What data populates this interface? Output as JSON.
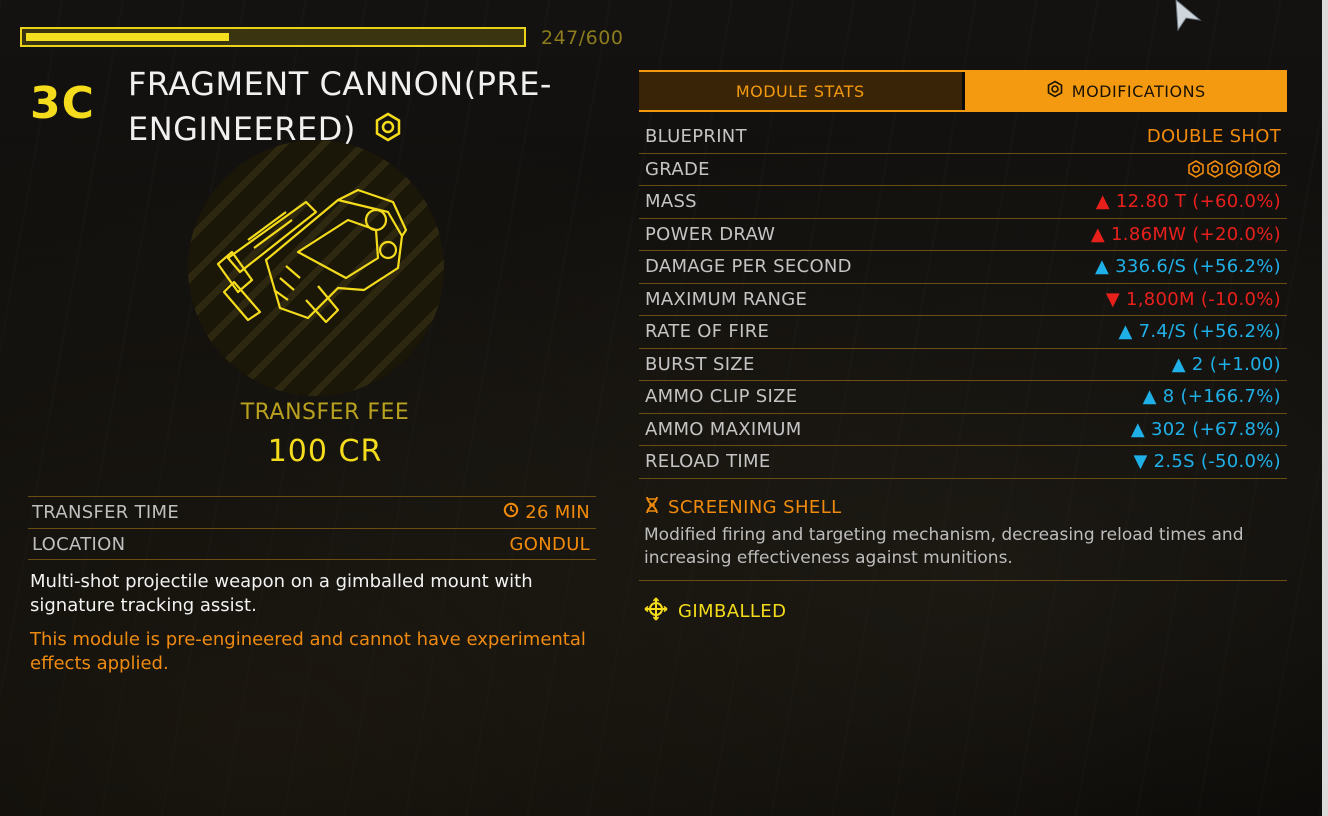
{
  "capacity": {
    "text": "247/600",
    "fraction": 0.4117
  },
  "module": {
    "class": "3C",
    "title": "FRAGMENT CANNON(PRE-ENGINEERED)",
    "icon": "engineered-hex-icon"
  },
  "transfer": {
    "fee_label": "TRANSFER FEE",
    "fee_value": "100 CR"
  },
  "info": [
    {
      "key": "TRANSFER TIME",
      "value": "26 MIN",
      "icon": "clock-icon"
    },
    {
      "key": "LOCATION",
      "value": "GONDUL"
    }
  ],
  "description": "Multi-shot projectile weapon on a gimballed mount with signature tracking assist.",
  "warning": "This module is pre-engineered and cannot have experimental effects applied.",
  "tabs": [
    {
      "label": "MODULE STATS",
      "active": false
    },
    {
      "label": "MODIFICATIONS",
      "active": true,
      "icon": "engineered-hex-icon"
    }
  ],
  "stats": [
    {
      "key": "BLUEPRINT",
      "value": "DOUBLE SHOT",
      "color": "orange"
    },
    {
      "key": "GRADE",
      "value": "",
      "grade": 5,
      "color": "orange"
    },
    {
      "key": "MASS",
      "value": "▲ 12.80 T (+60.0%)",
      "color": "red"
    },
    {
      "key": "POWER DRAW",
      "value": "▲ 1.86MW (+20.0%)",
      "color": "red"
    },
    {
      "key": "DAMAGE PER SECOND",
      "value": "▲ 336.6/S (+56.2%)",
      "color": "blue"
    },
    {
      "key": "MAXIMUM RANGE",
      "value": "▼ 1,800M (-10.0%)",
      "color": "red"
    },
    {
      "key": "RATE OF FIRE",
      "value": "▲ 7.4/S (+56.2%)",
      "color": "blue"
    },
    {
      "key": "BURST SIZE",
      "value": "▲ 2 (+1.00)",
      "color": "blue"
    },
    {
      "key": "AMMO CLIP SIZE",
      "value": "▲ 8 (+166.7%)",
      "color": "blue"
    },
    {
      "key": "AMMO MAXIMUM",
      "value": "▲ 302 (+67.8%)",
      "color": "blue"
    },
    {
      "key": "RELOAD TIME",
      "value": "▼ 2.5S (-50.0%)",
      "color": "blue"
    }
  ],
  "experimental": {
    "title": "SCREENING SHELL",
    "icon": "dna-icon",
    "description": "Modified firing and targeting mechanism, decreasing reload times and increasing effectiveness against munitions."
  },
  "mount": {
    "label": "GIMBALLED",
    "icon": "gimbal-icon"
  },
  "colors": {
    "accent_orange": "#f39a10",
    "accent_yellow": "#f4dc1c",
    "negative_red": "#e8201c",
    "positive_blue": "#1fb0e8"
  }
}
